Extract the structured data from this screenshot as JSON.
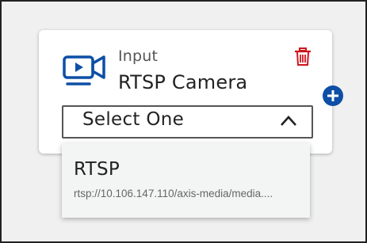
{
  "card": {
    "type_label": "Input",
    "name": "RTSP Camera",
    "icon": "video-camera-icon",
    "delete_icon": "trash-icon",
    "select": {
      "value": "Select One",
      "icon": "chevron-up-icon"
    }
  },
  "add_button": {
    "icon": "plus-circle-icon"
  },
  "dropdown": {
    "options": [
      {
        "title": "RTSP",
        "url": "rtsp://10.106.147.110/axis-media/media...."
      }
    ]
  },
  "colors": {
    "accent_blue": "#0d4fa6",
    "delete_red": "#d0141c",
    "background": "#f0f0f0",
    "card": "#ffffff",
    "dropdown": "#f3f4f4"
  }
}
